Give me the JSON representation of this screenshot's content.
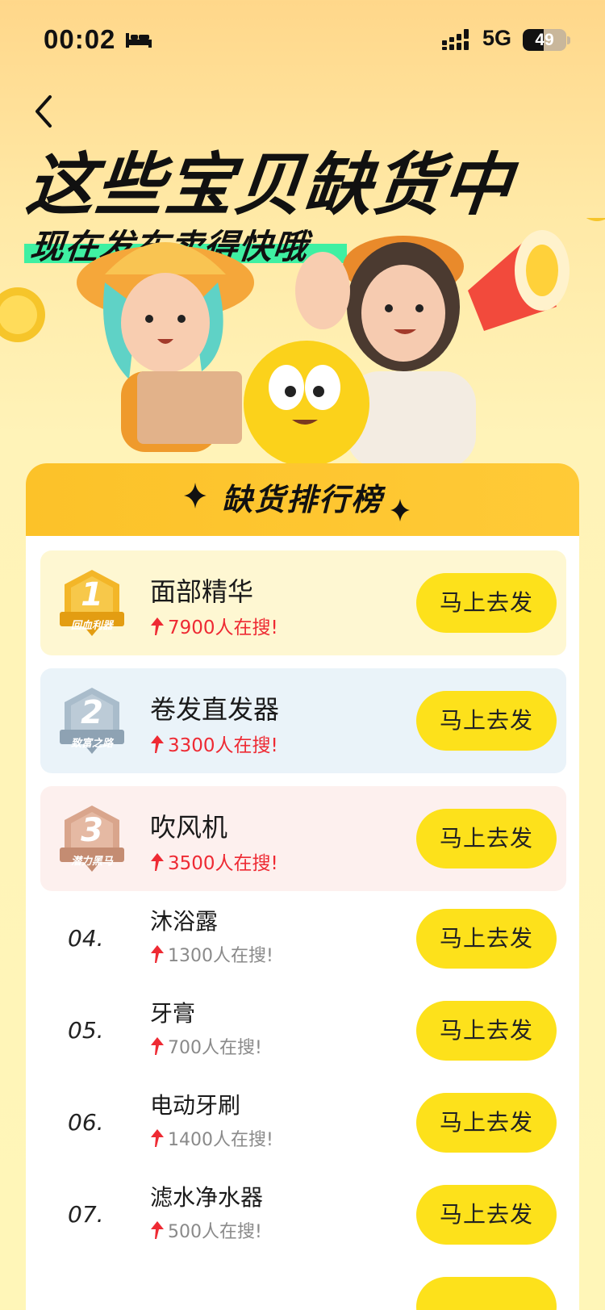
{
  "status_bar": {
    "time": "00:02",
    "network": "5G",
    "battery": "49",
    "battery_level": 0.49
  },
  "hero": {
    "title": "这些宝贝缺货中",
    "subtitle": "现在发布卖得快哦"
  },
  "ranking": {
    "title": "缺货排行榜",
    "top_items": [
      {
        "rank": "1",
        "badge": "回血利器",
        "name": "面部精华",
        "count": "7900人在搜!",
        "button": "马上去发"
      },
      {
        "rank": "2",
        "badge": "致富之路",
        "name": "卷发直发器",
        "count": "3300人在搜!",
        "button": "马上去发"
      },
      {
        "rank": "3",
        "badge": "潜力黑马",
        "name": "吹风机",
        "count": "3500人在搜!",
        "button": "马上去发"
      }
    ],
    "items": [
      {
        "rank": "04.",
        "name": "沐浴露",
        "count": "1300人在搜!",
        "button": "马上去发"
      },
      {
        "rank": "05.",
        "name": "牙膏",
        "count": "700人在搜!",
        "button": "马上去发"
      },
      {
        "rank": "06.",
        "name": "电动牙刷",
        "count": "1400人在搜!",
        "button": "马上去发"
      },
      {
        "rank": "07.",
        "name": "滤水净水器",
        "count": "500人在搜!",
        "button": "马上去发"
      }
    ]
  },
  "colors": {
    "accent_yellow": "#fde11b",
    "header_orange": "#fcc229",
    "highlight_green": "#3ff0a2",
    "count_red": "#ee2a33",
    "gold_medal": "#f3b628",
    "silver_medal": "#a9bccb",
    "bronze_medal": "#d9a58c"
  },
  "icons": {
    "bed": "bed-icon",
    "signal": "signal-icon",
    "back": "back-chevron-icon",
    "sparkle": "sparkle-icon",
    "arrow": "arrow-up-icon"
  }
}
